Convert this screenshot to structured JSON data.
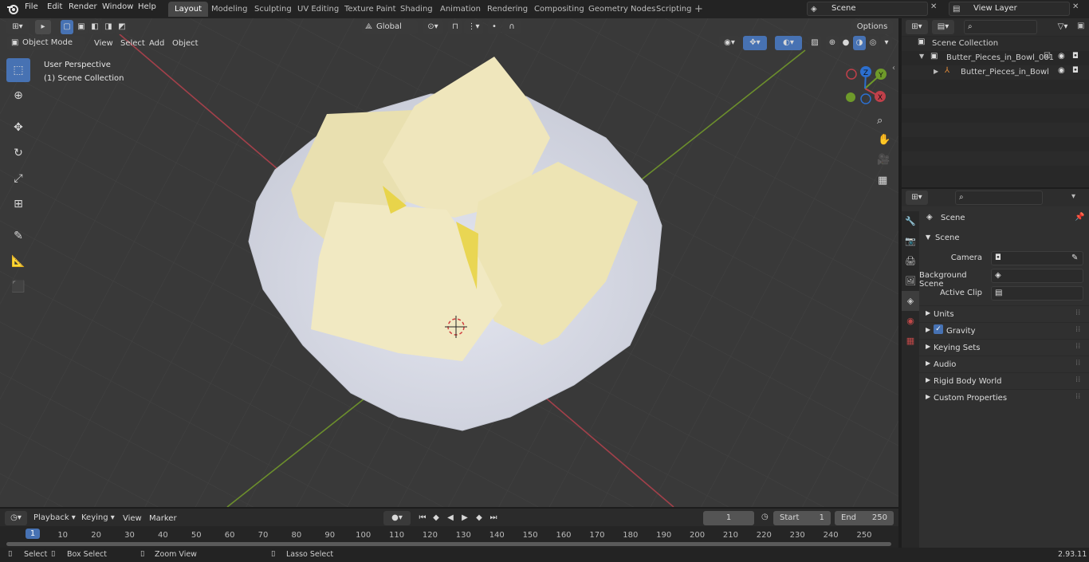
{
  "topbar": {
    "menus": [
      "File",
      "Edit",
      "Render",
      "Window",
      "Help"
    ],
    "tabs": [
      "Layout",
      "Modeling",
      "Sculpting",
      "UV Editing",
      "Texture Paint",
      "Shading",
      "Animation",
      "Rendering",
      "Compositing",
      "Geometry Nodes",
      "Scripting"
    ],
    "active_tab": "Layout",
    "scene": "Scene",
    "view_layer": "View Layer"
  },
  "viewport": {
    "mode": "Object Mode",
    "menus": [
      "View",
      "Select",
      "Add",
      "Object"
    ],
    "transform_orientation": "Global",
    "options": "Options",
    "overlay_title": "User Perspective",
    "overlay_subtitle": "(1) Scene Collection",
    "gizmo_axes": [
      "X",
      "Y",
      "Z"
    ]
  },
  "outliner": {
    "root": "Scene Collection",
    "items": [
      {
        "label": "Butter_Pieces_in_Bowl_001"
      },
      {
        "label": "Butter_Pieces_in_Bowl"
      }
    ]
  },
  "properties": {
    "context": "Scene",
    "panel": "Scene",
    "fields": [
      {
        "label": "Camera",
        "value": ""
      },
      {
        "label": "Background Scene",
        "value": ""
      },
      {
        "label": "Active Clip",
        "value": ""
      }
    ],
    "sections": [
      "Units",
      "Gravity",
      "Keying Sets",
      "Audio",
      "Rigid Body World",
      "Custom Properties"
    ]
  },
  "timeline": {
    "menus": [
      "Playback",
      "Keying",
      "View",
      "Marker"
    ],
    "current_frame": "1",
    "start_label": "Start",
    "start": "1",
    "end_label": "End",
    "end": "250",
    "ruler": [
      "1",
      "10",
      "20",
      "30",
      "40",
      "50",
      "60",
      "70",
      "80",
      "90",
      "100",
      "110",
      "120",
      "130",
      "140",
      "150",
      "160",
      "170",
      "180",
      "190",
      "200",
      "210",
      "220",
      "230",
      "240",
      "250"
    ]
  },
  "statusbar": {
    "select": "Select",
    "box_select": "Box Select",
    "zoom_view": "Zoom View",
    "lasso_select": "Lasso Select",
    "version": "2.93.11"
  },
  "colors": {
    "accent": "#4772b3",
    "x_axis": "#c0404a",
    "y_axis": "#6e9a2a",
    "z_axis": "#2c6fcf",
    "butter": "#ece3b4",
    "bowl": "#d9dbe6"
  }
}
